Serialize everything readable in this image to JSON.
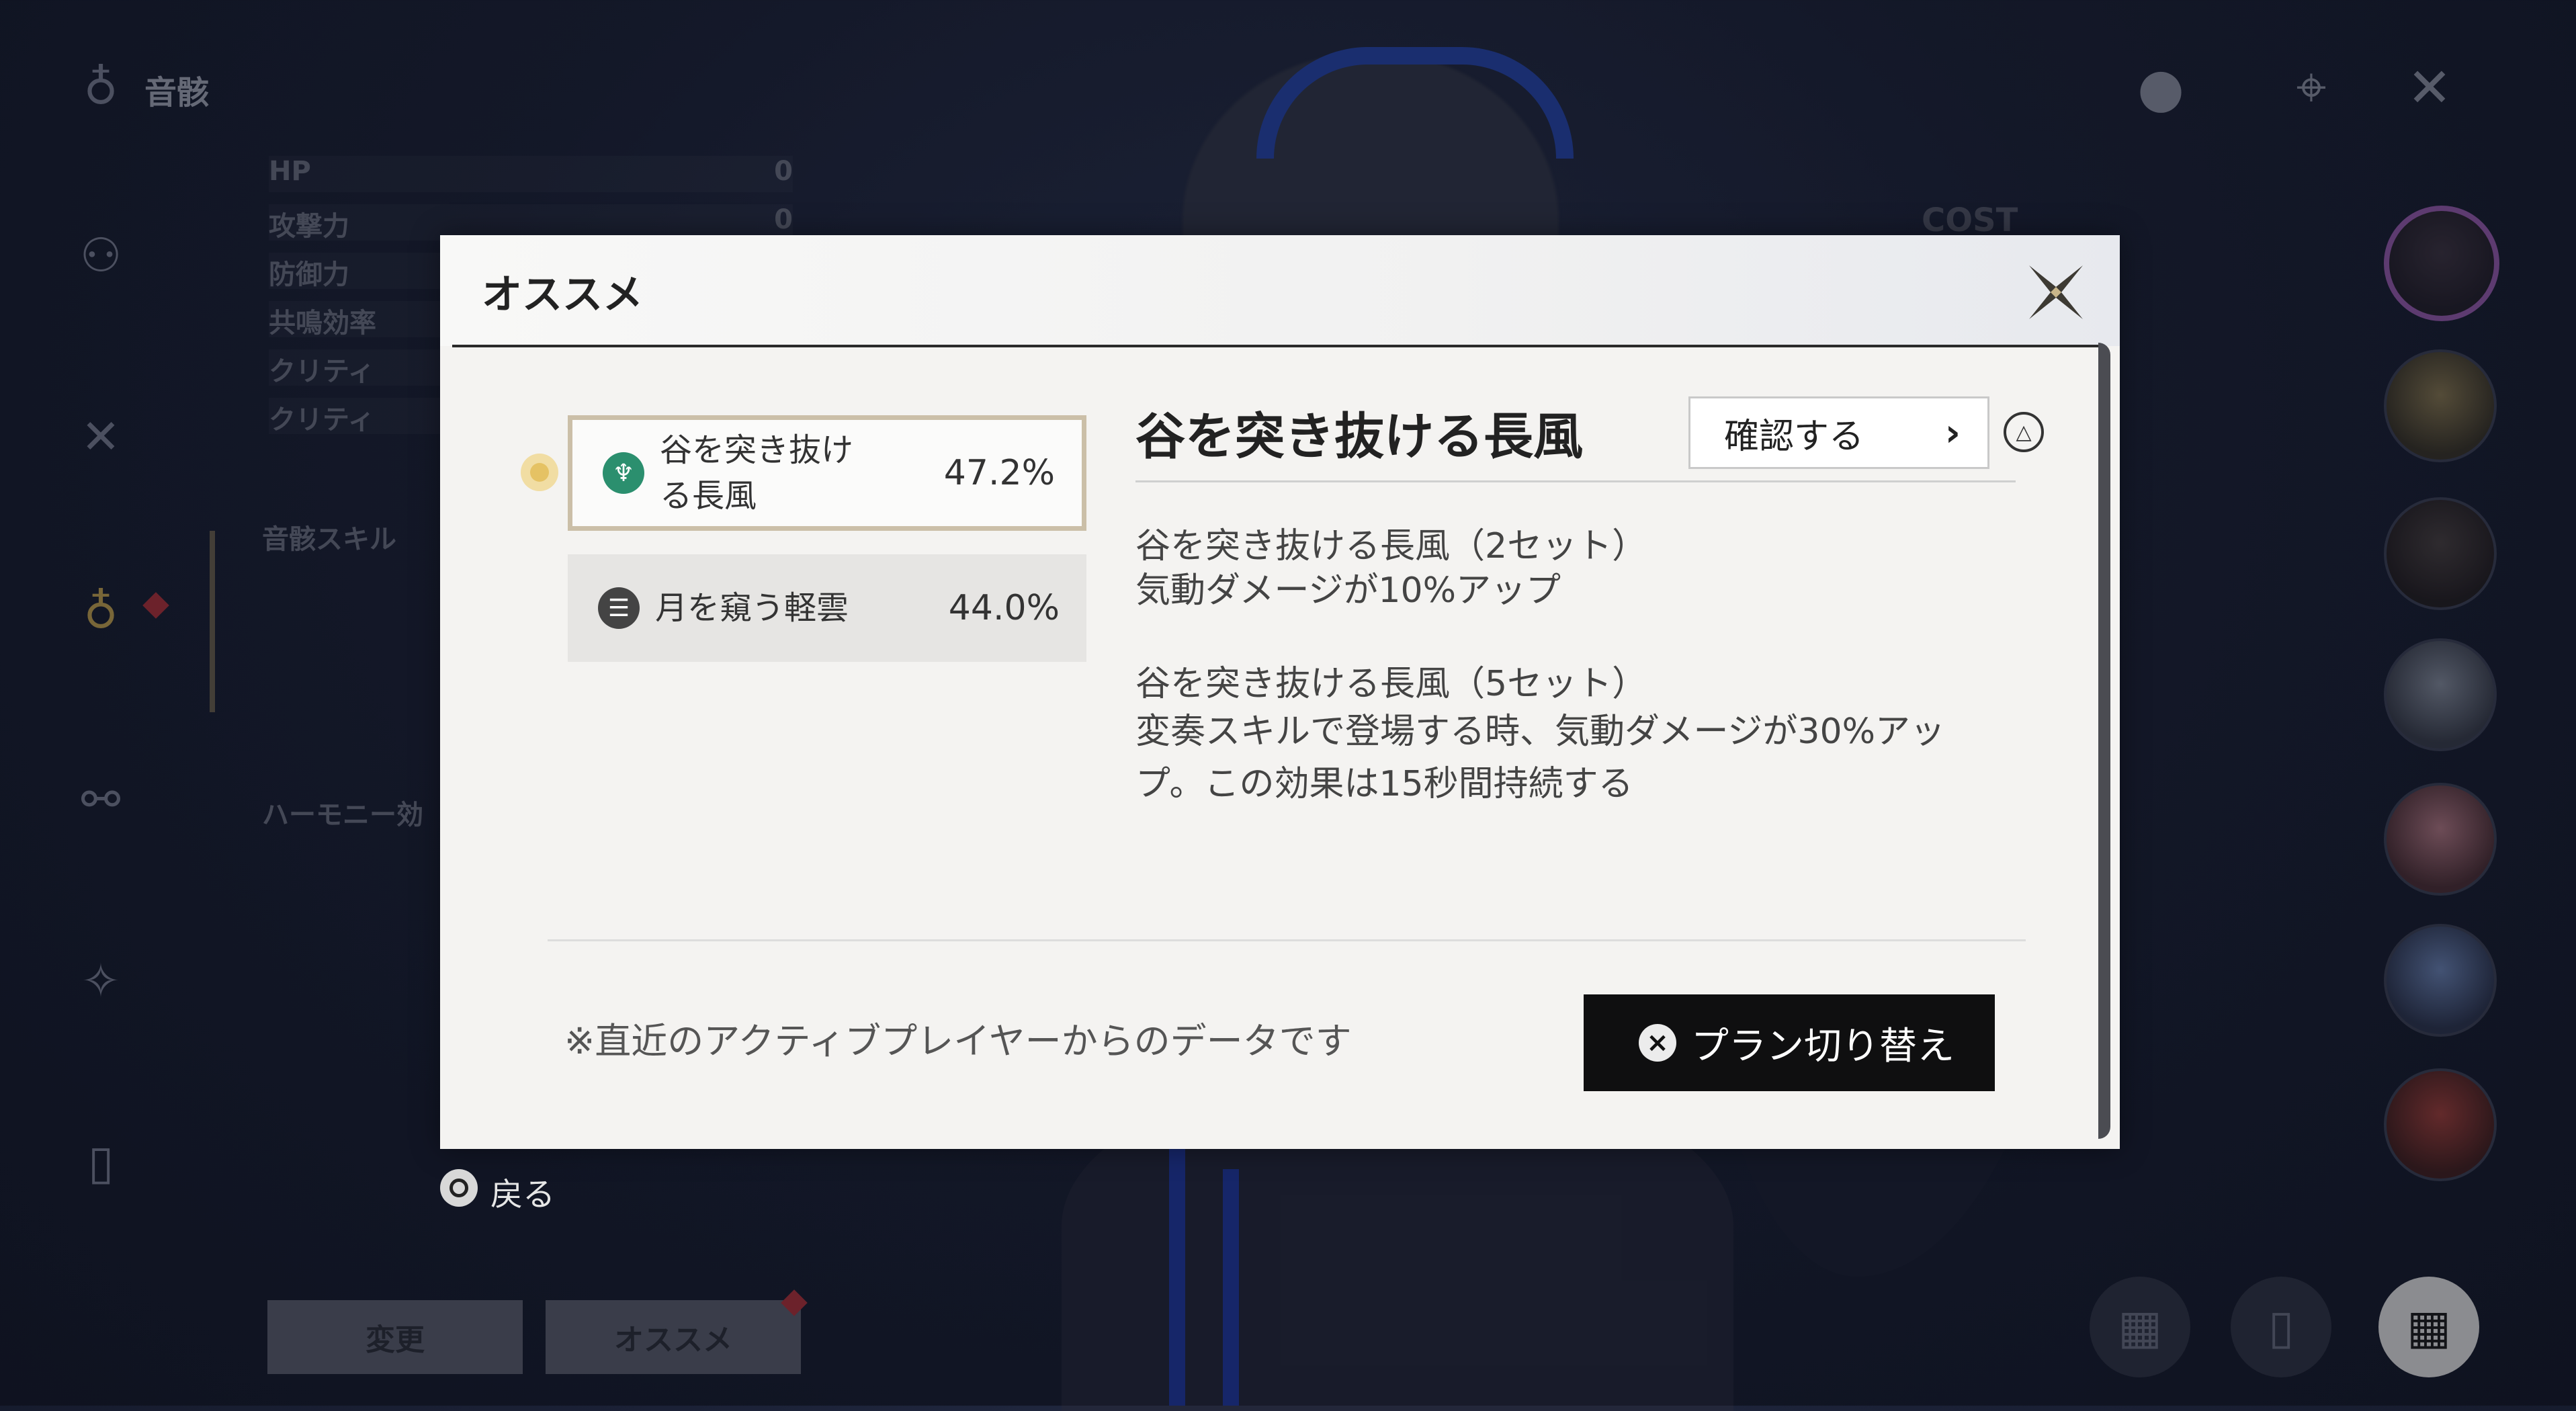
{
  "sidebar": {
    "title": "音骸",
    "icons": [
      "echo-icon",
      "character-icon",
      "weapon-icon",
      "echo-active-icon",
      "resonance-chain-icon",
      "skill-icon",
      "device-icon"
    ],
    "stats": [
      {
        "label": "HP",
        "value": "0"
      },
      {
        "label": "攻撃力",
        "value": "0"
      },
      {
        "label": "防御力",
        "value": ""
      },
      {
        "label": "共鳴効率",
        "value": ""
      },
      {
        "label": "クリティ",
        "value": ""
      },
      {
        "label": "クリティ",
        "value": ""
      }
    ],
    "section_skill": "音骸スキル",
    "section_harmony": "ハーモニー効"
  },
  "top_right": {
    "icons": [
      "info-icon",
      "target-icon",
      "close-icon"
    ]
  },
  "background": {
    "cost_label": "COST"
  },
  "bottom_left": {
    "change_label": "変更",
    "recommend_label": "オススメ"
  },
  "dialog": {
    "title": "オススメ",
    "sets": [
      {
        "name": "谷を突き抜ける長風",
        "percent": "47.2%",
        "icon_color": "#2b8f6e"
      },
      {
        "name": "月を窺う軽雲",
        "percent": "44.0%",
        "icon_color": "#444444"
      }
    ],
    "detail": {
      "title": "谷を突き抜ける長風",
      "confirm_label": "確認する",
      "effects": [
        {
          "head": "谷を突き抜ける長風（2セット）",
          "text": "気動ダメージが10%アップ"
        },
        {
          "head": "谷を突き抜ける長風（5セット）",
          "text": "変奏スキルで登場する時、気動ダメージが30%アップ。この効果は15秒間持続する"
        }
      ]
    },
    "note": "※直近のアクティブプレイヤーからのデータです",
    "switch_label": "プラン切り替え"
  },
  "back_label": "戻る",
  "colors": {
    "accent_gold": "#cbbfa8",
    "dialog_bg": "#f4f3f1",
    "switch_bg": "#0f0f10",
    "alert_red": "#b3323b"
  }
}
